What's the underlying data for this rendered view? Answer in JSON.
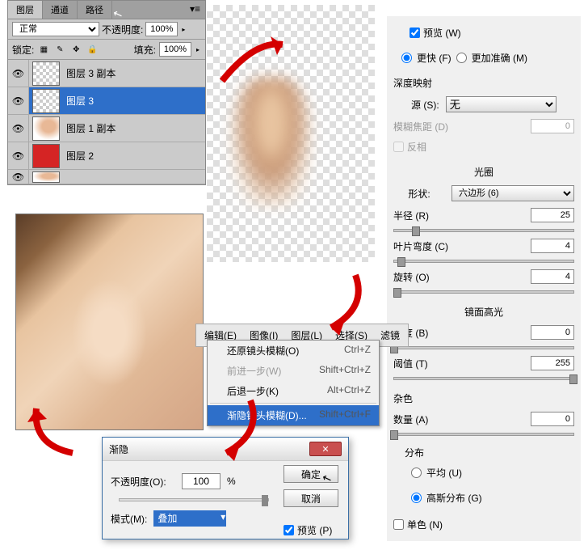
{
  "layers_panel": {
    "tabs": [
      "图层",
      "通道",
      "路径"
    ],
    "blend_mode": "正常",
    "opacity_label": "不透明度:",
    "opacity_value": "100%",
    "lock_label": "锁定:",
    "fill_label": "填充:",
    "fill_value": "100%",
    "layers": [
      {
        "name": "图层 3 副本",
        "visible": true,
        "selected": false
      },
      {
        "name": "图层 3",
        "visible": true,
        "selected": true
      },
      {
        "name": "图层 1 副本",
        "visible": true,
        "selected": false
      },
      {
        "name": "图层 2",
        "visible": true,
        "selected": false
      },
      {
        "name": "",
        "visible": true,
        "selected": false
      }
    ]
  },
  "right_panel": {
    "preview_label": "预览 (W)",
    "faster_label": "更快 (F)",
    "accurate_label": "更加准确 (M)",
    "depth_label": "深度映射",
    "source_label": "源 (S):",
    "source_value": "无",
    "blur_dist_label": "模糊焦距 (D)",
    "blur_dist_value": "0",
    "invert_label": "反相",
    "aperture_label": "光圈",
    "shape_label": "形状:",
    "shape_value": "六边形 (6)",
    "radius_label": "半径 (R)",
    "radius_value": "25",
    "blade_label": "叶片弯度 (C)",
    "blade_value": "4",
    "rotate_label": "旋转 (O)",
    "rotate_value": "4",
    "specular_label": "镜面高光",
    "bright_label": "亮度 (B)",
    "bright_value": "0",
    "threshold_label": "阈值 (T)",
    "threshold_value": "255",
    "noise_label": "杂色",
    "amount_label": "数量 (A)",
    "amount_value": "0",
    "dist_label": "分布",
    "uniform_label": "平均 (U)",
    "gaussian_label": "高斯分布 (G)",
    "mono_label": "单色 (N)"
  },
  "menu_bar": {
    "items": [
      "编辑(E)",
      "图像(I)",
      "图层(L)",
      "选择(S)",
      "滤镜"
    ]
  },
  "dropdown": {
    "undo": {
      "label": "还原镜头模糊(O)",
      "shortcut": "Ctrl+Z"
    },
    "forward": {
      "label": "前进一步(W)",
      "shortcut": "Shift+Ctrl+Z"
    },
    "backward": {
      "label": "后退一步(K)",
      "shortcut": "Alt+Ctrl+Z"
    },
    "fade": {
      "label": "渐隐镜头模糊(D)...",
      "shortcut": "Shift+Ctrl+F"
    }
  },
  "fade_dialog": {
    "title": "渐隐",
    "opacity_label": "不透明度(O):",
    "opacity_value": "100",
    "percent": "%",
    "mode_label": "模式(M):",
    "mode_value": "叠加",
    "ok_label": "确定",
    "cancel_label": "取消",
    "preview_label": "预览 (P)"
  }
}
